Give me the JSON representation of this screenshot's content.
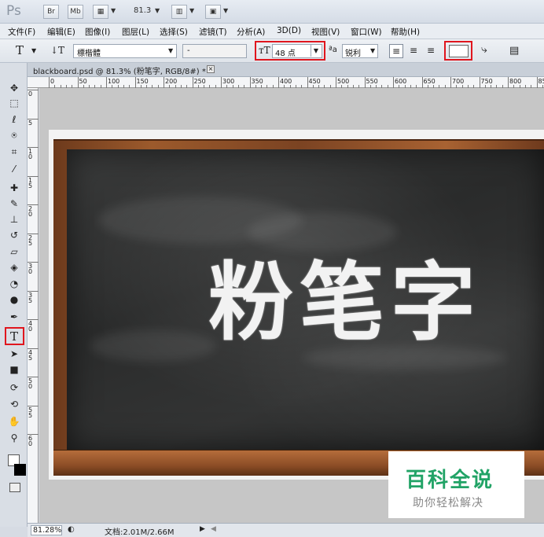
{
  "app": {
    "logo": "Ps",
    "bridge_label": "Br",
    "minibridge_label": "Mb",
    "zoom_level": "81.3"
  },
  "menu": [
    "文件(F)",
    "编辑(E)",
    "图像(I)",
    "图层(L)",
    "选择(S)",
    "滤镜(T)",
    "分析(A)",
    "3D(D)",
    "视图(V)",
    "窗口(W)",
    "帮助(H)"
  ],
  "options": {
    "tool_glyph": "T",
    "font_family": "標楷體",
    "font_style": "-",
    "font_size": "48 点",
    "antialias": "锐利",
    "color_hex": "#ffffff",
    "highlight_color": "#e0161e"
  },
  "document": {
    "tab_title": "blackboard.psd @ 81.3% (粉笔字, RGB/8#) *",
    "close_glyph": "×",
    "canvas_text": "粉笔字",
    "ruler_labels": [
      "0",
      "50",
      "100",
      "150",
      "200",
      "250",
      "300",
      "350",
      "400",
      "450",
      "500",
      "550",
      "600",
      "650",
      "700",
      "750",
      "800",
      "850"
    ],
    "vruler_labels": [
      "0",
      "5",
      "1 0",
      "1 5",
      "2 0",
      "2 5",
      "3 0",
      "3 5",
      "4 0",
      "4 5",
      "5 0",
      "5 5",
      "6 0"
    ]
  },
  "status": {
    "zoom": "81.28%",
    "doc_size": "文档:2.01M/2.66M"
  },
  "watermark": {
    "title": "百科全说",
    "subtitle": "助你轻松解决",
    "color": "#21a366"
  },
  "tools": [
    {
      "name": "move-tool",
      "glyph": "✥"
    },
    {
      "name": "marquee-tool",
      "glyph": "⬚"
    },
    {
      "name": "lasso-tool",
      "glyph": "ℓ"
    },
    {
      "name": "quick-select-tool",
      "glyph": "⍟"
    },
    {
      "name": "crop-tool",
      "glyph": "⌗"
    },
    {
      "name": "eyedropper-tool",
      "glyph": "⁄"
    },
    {
      "name": "healing-brush-tool",
      "glyph": "✚"
    },
    {
      "name": "brush-tool",
      "glyph": "✎"
    },
    {
      "name": "clone-stamp-tool",
      "glyph": "⊥"
    },
    {
      "name": "history-brush-tool",
      "glyph": "↺"
    },
    {
      "name": "eraser-tool",
      "glyph": "▱"
    },
    {
      "name": "paint-bucket-tool",
      "glyph": "◈"
    },
    {
      "name": "blur-tool",
      "glyph": "◔"
    },
    {
      "name": "dodge-tool",
      "glyph": "●"
    },
    {
      "name": "pen-tool",
      "glyph": "✒"
    },
    {
      "name": "type-tool",
      "glyph": "T"
    },
    {
      "name": "path-select-tool",
      "glyph": "➤"
    },
    {
      "name": "shape-tool",
      "glyph": "■"
    },
    {
      "name": "3d-rotate-tool",
      "glyph": "⟳"
    },
    {
      "name": "3d-orbit-tool",
      "glyph": "⟲"
    },
    {
      "name": "hand-tool",
      "glyph": "✋"
    },
    {
      "name": "zoom-tool",
      "glyph": "⚲"
    }
  ]
}
